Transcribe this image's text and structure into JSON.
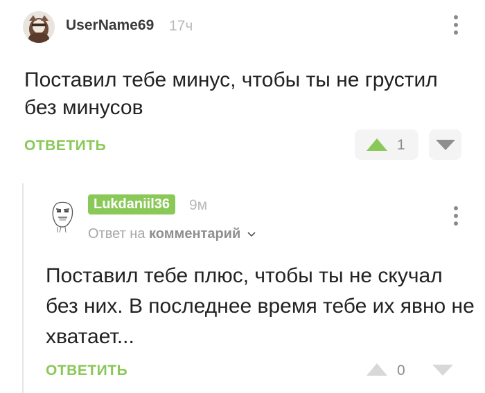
{
  "colors": {
    "accent_green": "#8ac858",
    "meta_gray": "#b9b9b9",
    "text": "#222222"
  },
  "comment": {
    "avatar_icon": "user-avatar-icon",
    "username": "UserName69",
    "time": "17ч",
    "text": "Поставил тебе минус, чтобы ты не грустил без минусов",
    "reply_label": "ОТВЕТИТЬ",
    "rating": "1",
    "menu_icon": "more-vertical-icon"
  },
  "reply": {
    "avatar_icon": "troll-face-avatar-icon",
    "username": "Lukdaniil36",
    "time": "9м",
    "reply_to_prefix": "Ответ на",
    "reply_to_link": "комментарий",
    "text": "Поставил тебе плюс, чтобы ты не скучал без них. В последнее время тебе их явно не хватает...",
    "reply_label": "ОТВЕТИТЬ",
    "rating": "0",
    "menu_icon": "more-vertical-icon"
  }
}
